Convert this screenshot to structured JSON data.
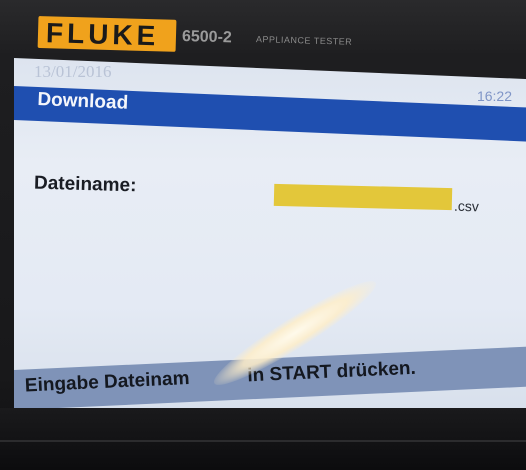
{
  "device": {
    "brand": "FLUKE",
    "model": "6500-2",
    "product": "APPLIANCE TESTER"
  },
  "screen": {
    "date": "13/01/2016",
    "title": "Download",
    "time": "16:22",
    "field": {
      "label": "Dateiname:",
      "value": "",
      "extension": ".csv"
    },
    "status_visible_left": "Eingabe Dateinam",
    "status_visible_right": "in START drücken."
  },
  "colors": {
    "logo": "#f0a21c",
    "title_bar": "#1f4fb0",
    "input_field": "#e3c73a",
    "status_bar": "#7f93b8"
  }
}
